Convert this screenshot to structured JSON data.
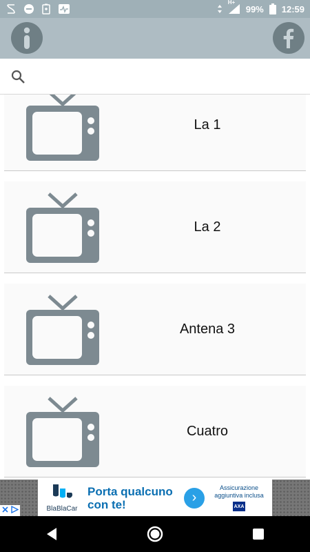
{
  "status_bar": {
    "battery": "99%",
    "time": "12:59",
    "network": "H+",
    "icons": [
      "swiftkey-icon",
      "do-not-disturb-icon",
      "battery-saver-icon",
      "activity-icon",
      "signal-icon",
      "battery-icon"
    ]
  },
  "app_bar": {
    "info_icon": "info-icon",
    "facebook_icon": "facebook-icon",
    "info_glyph": "i",
    "facebook_glyph": "f"
  },
  "search": {
    "placeholder": "",
    "value": ""
  },
  "channels": [
    {
      "name": "La 1",
      "icon": "tv-icon"
    },
    {
      "name": "La 2",
      "icon": "tv-icon"
    },
    {
      "name": "Antena 3",
      "icon": "tv-icon"
    },
    {
      "name": "Cuatro",
      "icon": "tv-icon"
    }
  ],
  "ad": {
    "brand": "BlaBlaCar",
    "headline": "Porta qualcuno con te!",
    "side_text": "Assicurazione aggiuntiva inclusa",
    "side_logo": "AXA",
    "arrow": "›",
    "colors": {
      "brand": "#0b6fb2",
      "arrow": "#2aa0e6"
    }
  },
  "nav": {
    "back_icon": "back-icon",
    "home_icon": "home-icon",
    "recents_icon": "recents-icon"
  }
}
